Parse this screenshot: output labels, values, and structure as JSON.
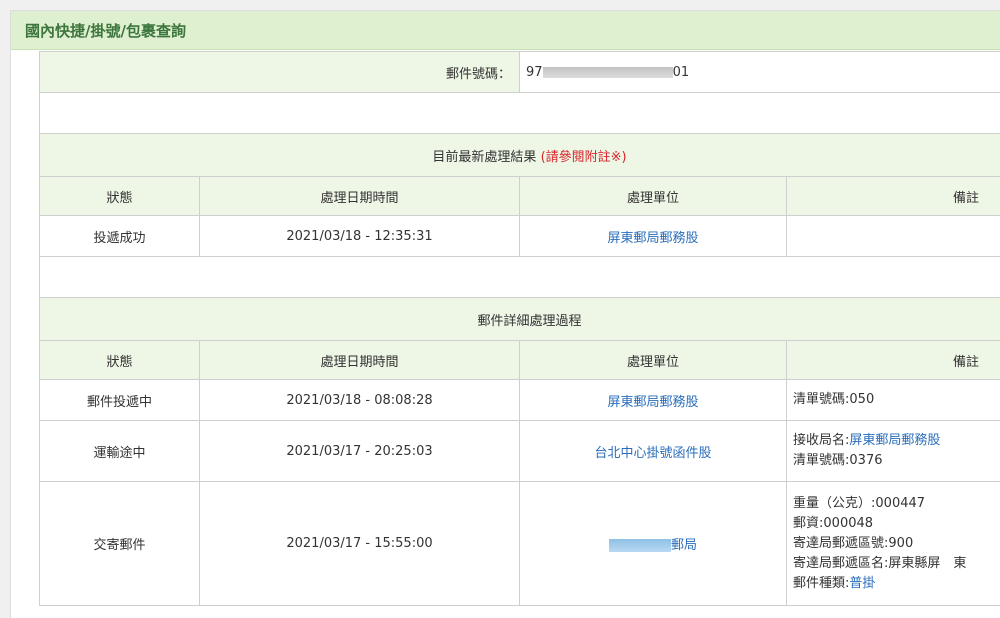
{
  "panel": {
    "title": "國內快捷/掛號/包裹查詢"
  },
  "tracking": {
    "label": "郵件號碼：",
    "number_prefix": "97",
    "number_suffix": "01"
  },
  "latest": {
    "title": "目前最新處理結果",
    "note": "(請參閱附註※)",
    "columns": [
      "狀態",
      "處理日期時間",
      "處理單位",
      "備註"
    ],
    "row": {
      "status": "投遞成功",
      "datetime": "2021/03/18 - 12:35:31",
      "unit": "屏東郵局郵務股",
      "remark": ""
    }
  },
  "details": {
    "title": "郵件詳細處理過程",
    "columns": [
      "狀態",
      "處理日期時間",
      "處理單位",
      "備註"
    ],
    "rows": [
      {
        "status": "郵件投遞中",
        "datetime": "2021/03/18 - 08:08:28",
        "unit": "屏東郵局郵務股",
        "remark_lines": [
          "清單號碼:050"
        ]
      },
      {
        "status": "運輸途中",
        "datetime": "2021/03/17 - 20:25:03",
        "unit": "台北中心掛號函件股",
        "remark_label": "接收局名:",
        "remark_link": "屏東郵局郵務股",
        "remark_lines": [
          "清單號碼:0376"
        ]
      },
      {
        "status": "交寄郵件",
        "datetime": "2021/03/17 - 15:55:00",
        "unit_suffix": "郵局",
        "remark_lines": [
          "重量（公克）:000447",
          "郵資:000048",
          "寄達局郵遞區號:900",
          "寄達局郵遞區名:屏東縣屏　東"
        ],
        "remark_type_label": "郵件種類:",
        "remark_type_link": "普掛"
      }
    ]
  },
  "colors": {
    "header_bg": "#dff0d0",
    "header_text": "#3c763d",
    "link": "#2a6ebb",
    "note": "#d9262b"
  }
}
